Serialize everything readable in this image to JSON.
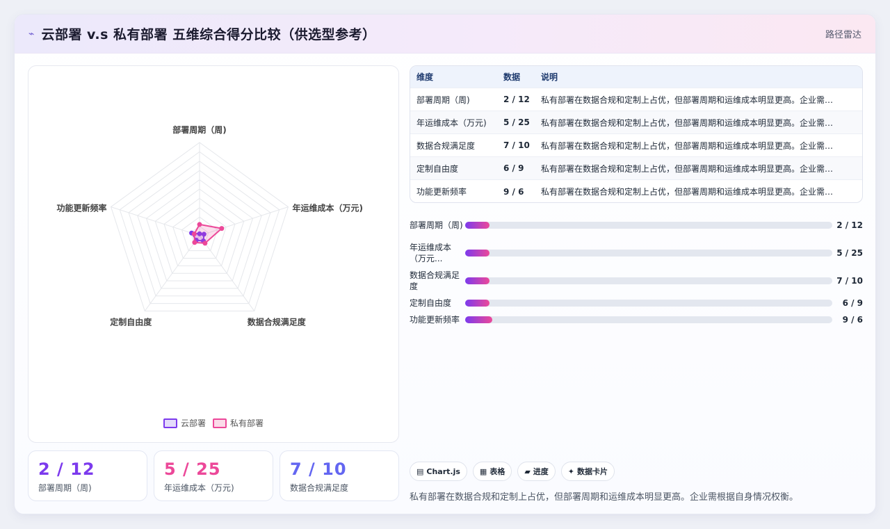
{
  "header": {
    "icon": "sparkle-icon",
    "title": "云部署 v.s 私有部署 五维综合得分比较（供选型参考）",
    "right_label": "路径雷达"
  },
  "chart_data": {
    "type": "radar",
    "axes": [
      "部署周期（周)",
      "年运维成本（万元)",
      "数据合规满足度",
      "定制自由度",
      "功能更新频率"
    ],
    "rmax": 100,
    "series": [
      {
        "name": "云部署",
        "values": [
          2,
          5,
          7,
          6,
          9
        ],
        "color": "#7c3aed"
      },
      {
        "name": "私有部署",
        "values": [
          12,
          25,
          10,
          9,
          6
        ],
        "color": "#ec4899"
      }
    ],
    "legend_position": "bottom"
  },
  "kpis": [
    {
      "value": "2 / 12",
      "label": "部署周期（周)",
      "color": "#7c3aed"
    },
    {
      "value": "5 / 25",
      "label": "年运维成本（万元)",
      "color": "#ec4899"
    },
    {
      "value": "7 / 10",
      "label": "数据合规满足度",
      "color": "#6366f1"
    }
  ],
  "table": {
    "headers": [
      "维度",
      "数据",
      "说明"
    ],
    "rows": [
      {
        "dim": "部署周期（周)",
        "data": "2 / 12",
        "desc": "私有部署在数据合规和定制上占优，但部署周期和运维成本明显更高。企业需根据自身情况权衡。"
      },
      {
        "dim": "年运维成本（万元)",
        "data": "5 / 25",
        "desc": "私有部署在数据合规和定制上占优，但部署周期和运维成本明显更高。企业需根据自身情况权衡。"
      },
      {
        "dim": "数据合规满足度",
        "data": "7 / 10",
        "desc": "私有部署在数据合规和定制上占优，但部署周期和运维成本明显更高。企业需根据自身情况权衡。"
      },
      {
        "dim": "定制自由度",
        "data": "6 / 9",
        "desc": "私有部署在数据合规和定制上占优，但部署周期和运维成本明显更高。企业需根据自身情况权衡。"
      },
      {
        "dim": "功能更新频率",
        "data": "9 / 6",
        "desc": "私有部署在数据合规和定制上占优，但部署周期和运维成本明显更高。企业需根据自身情况权衡。"
      }
    ]
  },
  "progress": [
    {
      "label": "部署周期（周)",
      "value": "2 / 12",
      "fraction": 0.066
    },
    {
      "label": "年运维成本（万元...",
      "value": "5 / 25",
      "fraction": 0.066
    },
    {
      "label": "数据合规满足度",
      "value": "7 / 10",
      "fraction": 0.066
    },
    {
      "label": "定制自由度",
      "value": "6 / 9",
      "fraction": 0.066
    },
    {
      "label": "功能更新频率",
      "value": "9 / 6",
      "fraction": 0.074
    }
  ],
  "chips": [
    {
      "icon": "chart-icon",
      "glyph": "▤",
      "label": "Chart.js"
    },
    {
      "icon": "table-icon",
      "glyph": "▦",
      "label": "表格"
    },
    {
      "icon": "progress-icon",
      "glyph": "▰",
      "label": "进度"
    },
    {
      "icon": "card-icon",
      "glyph": "✦",
      "label": "数据卡片"
    }
  ],
  "summary": "私有部署在数据合规和定制上占优，但部署周期和运维成本明显更高。企业需根据自身情况权衡。"
}
